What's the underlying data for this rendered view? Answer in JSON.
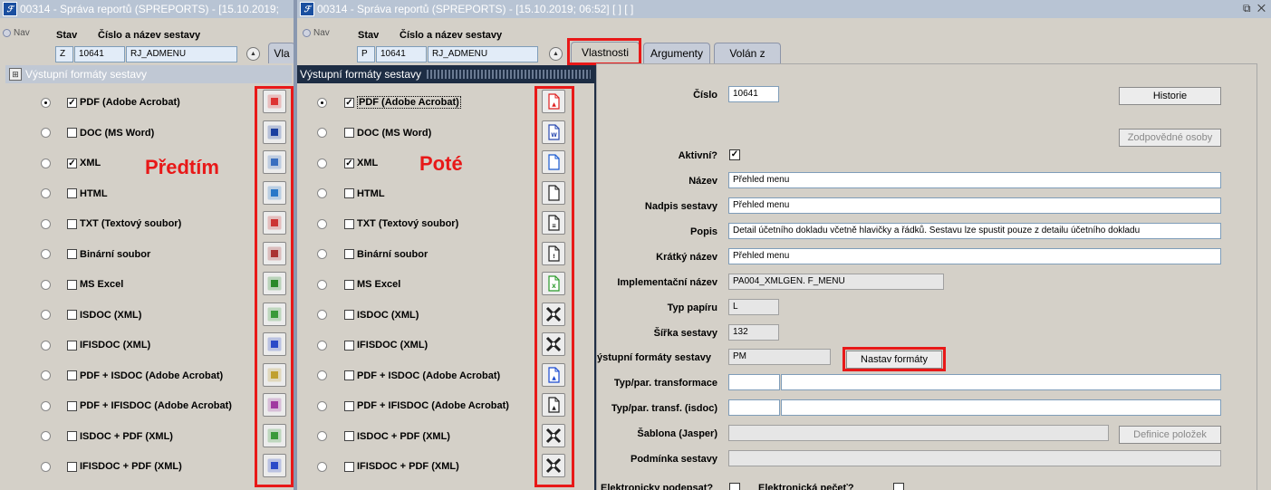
{
  "window_left": {
    "title": "00314 - Správa reportů (SPREPORTS) - [15.10.2019;"
  },
  "window_right": {
    "title": "00314 - Správa reportů (SPREPORTS) - [15.10.2019; 06:52]  [ ]  [ ]",
    "controls": "⧉ ✕"
  },
  "nav_label": "Nav",
  "header": {
    "stav_label": "Stav",
    "cislo_label": "Číslo a název sestavy",
    "left_stav": "Z",
    "right_stav": "P",
    "cislo": "10641",
    "nazev": "RJ_ADMENU",
    "partial_tab": "Vla"
  },
  "tabs": [
    "Vlastnosti",
    "Argumenty",
    "Volán z"
  ],
  "panel_title": "Výstupní formáty sestavy",
  "annotations": {
    "before": "Předtím",
    "after": "Poté"
  },
  "formats": [
    {
      "label": "PDF (Adobe Acrobat)",
      "checked": true,
      "selected": true
    },
    {
      "label": "DOC (MS Word)",
      "checked": false,
      "selected": false
    },
    {
      "label": "XML",
      "checked": true,
      "selected": false
    },
    {
      "label": "HTML",
      "checked": false,
      "selected": false
    },
    {
      "label": "TXT (Textový soubor)",
      "checked": false,
      "selected": false
    },
    {
      "label": "Binární soubor",
      "checked": false,
      "selected": false
    },
    {
      "label": "MS Excel",
      "checked": false,
      "selected": false
    },
    {
      "label": "ISDOC (XML)",
      "checked": false,
      "selected": false
    },
    {
      "label": "IFISDOC (XML)",
      "checked": false,
      "selected": false
    },
    {
      "label": "PDF + ISDOC (Adobe Acrobat)",
      "checked": false,
      "selected": false
    },
    {
      "label": "PDF + IFISDOC (Adobe Acrobat)",
      "checked": false,
      "selected": false
    },
    {
      "label": "ISDOC + PDF (XML)",
      "checked": false,
      "selected": false
    },
    {
      "label": "IFISDOC + PDF (XML)",
      "checked": false,
      "selected": false
    }
  ],
  "icons_old": [
    "pdf-icon",
    "word-icon",
    "xml-icon",
    "html-icon",
    "txt-icon",
    "binary-icon",
    "excel-icon",
    "isdoc-icon",
    "ifisdoc-icon",
    "pdf-isdoc-icon",
    "pdf-ifisdoc-icon",
    "isdoc-pdf-icon",
    "ifisdoc-pdf-icon"
  ],
  "props": {
    "cislo_label": "Číslo",
    "cislo": "10641",
    "historie": "Historie",
    "zodpovedne": "Zodpovědné osoby",
    "aktivni_label": "Aktivní?",
    "nazev_label": "Název",
    "nazev": "Přehled menu",
    "nadpis_label": "Nadpis sestavy",
    "nadpis": "Přehled menu",
    "popis_label": "Popis",
    "popis": "Detail účetního dokladu včetně hlavičky a řádků. Sestavu lze spustit pouze z detailu účetního dokladu",
    "kratky_label": "Krátký název",
    "kratky": "Přehled menu",
    "impl_label": "Implementační název",
    "impl": "PA004_XMLGEN. F_MENU",
    "typ_label": "Typ papíru",
    "typ": "L",
    "sirka_label": "Šířka sestavy",
    "sirka": "132",
    "vystup_label": "ýstupní formáty sestavy",
    "vystup": "PM",
    "nastav": "Nastav formáty",
    "transf_label": "Typ/par. transformace",
    "transf_isdoc_label": "Typ/par. transf. (isdoc)",
    "sablona_label": "Šablona (Jasper)",
    "definice": "Definice položek",
    "podminka_label": "Podmínka sestavy",
    "el_podpis_label": "Elektronicky podepsat?",
    "el_pecet_label": "Elektronická pečeť?"
  },
  "colors": {
    "highlight": "#e81818",
    "panel_header": "#1d2d44"
  }
}
